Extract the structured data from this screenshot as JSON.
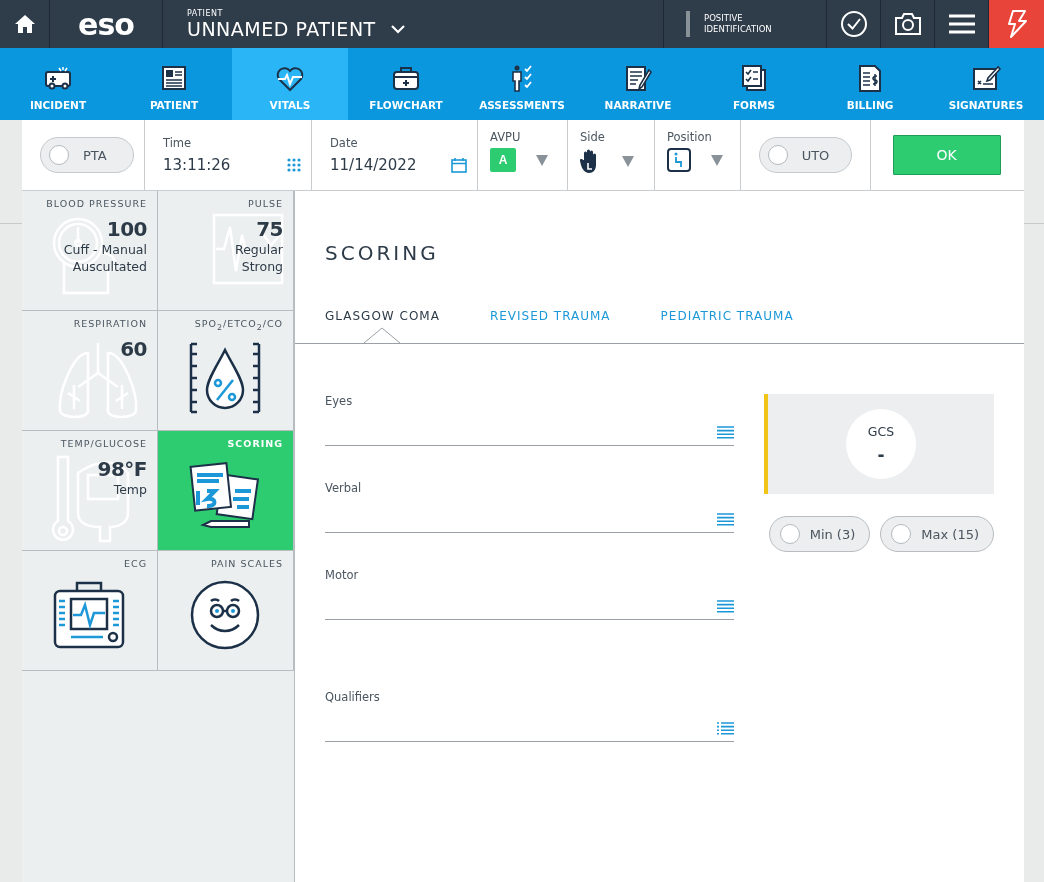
{
  "header": {
    "logo": "eso",
    "patient_label": "PATIENT",
    "patient_name": "UNNAMED PATIENT",
    "identification": "POSITIVE IDENTIFICATION"
  },
  "nav_tabs": [
    {
      "label": "INCIDENT",
      "selected": false
    },
    {
      "label": "PATIENT",
      "selected": false
    },
    {
      "label": "VITALS",
      "selected": true
    },
    {
      "label": "FLOWCHART",
      "selected": false
    },
    {
      "label": "ASSESSMENTS",
      "selected": false
    },
    {
      "label": "NARRATIVE",
      "selected": false
    },
    {
      "label": "FORMS",
      "selected": false
    },
    {
      "label": "BILLING",
      "selected": false
    },
    {
      "label": "SIGNATURES",
      "selected": false
    }
  ],
  "toolbar": {
    "pta": {
      "label": "PTA",
      "on": false
    },
    "time": {
      "label": "Time",
      "value": "13:11:26"
    },
    "date": {
      "label": "Date",
      "value": "11/14/2022"
    },
    "avpu": {
      "label": "AVPU",
      "value": "A"
    },
    "side": {
      "label": "Side"
    },
    "position": {
      "label": "Position"
    },
    "uto": {
      "label": "UTO",
      "on": false
    },
    "ok": "OK"
  },
  "tiles": [
    {
      "title": "BLOOD PRESSURE",
      "value": "100",
      "details": [
        "Cuff - Manual",
        "Auscultated"
      ],
      "selected": false
    },
    {
      "title": "PULSE",
      "value": "75",
      "details": [
        "Regular",
        "Strong"
      ],
      "selected": false
    },
    {
      "title": "RESPIRATION",
      "value": "60",
      "selected": false
    },
    {
      "title": "SPO$_{2}$/ETCO$_{2}$/CO",
      "selected": false
    },
    {
      "title": "TEMP/GLUCOSE",
      "value": "98°F",
      "details": [
        "Temp"
      ],
      "selected": false
    },
    {
      "title": "SCORING",
      "selected": true
    },
    {
      "title": "ECG",
      "selected": false
    },
    {
      "title": "PAIN SCALES",
      "selected": false
    }
  ],
  "scoring": {
    "title": "SCORING",
    "tabs": [
      {
        "label": "GLASGOW COMA",
        "selected": true
      },
      {
        "label": "REVISED TRAUMA",
        "selected": false
      },
      {
        "label": "PEDIATRIC TRAUMA",
        "selected": false
      }
    ],
    "fields": [
      {
        "label": "Eyes",
        "kind": "menu"
      },
      {
        "label": "Verbal",
        "kind": "menu"
      },
      {
        "label": "Motor",
        "kind": "menu"
      },
      {
        "label": "Qualifiers",
        "kind": "list"
      }
    ],
    "gcs": {
      "label": "GCS",
      "value": "-"
    },
    "options": [
      {
        "label": "Min (3)",
        "selected": false
      },
      {
        "label": "Max (15)",
        "selected": false
      }
    ]
  }
}
